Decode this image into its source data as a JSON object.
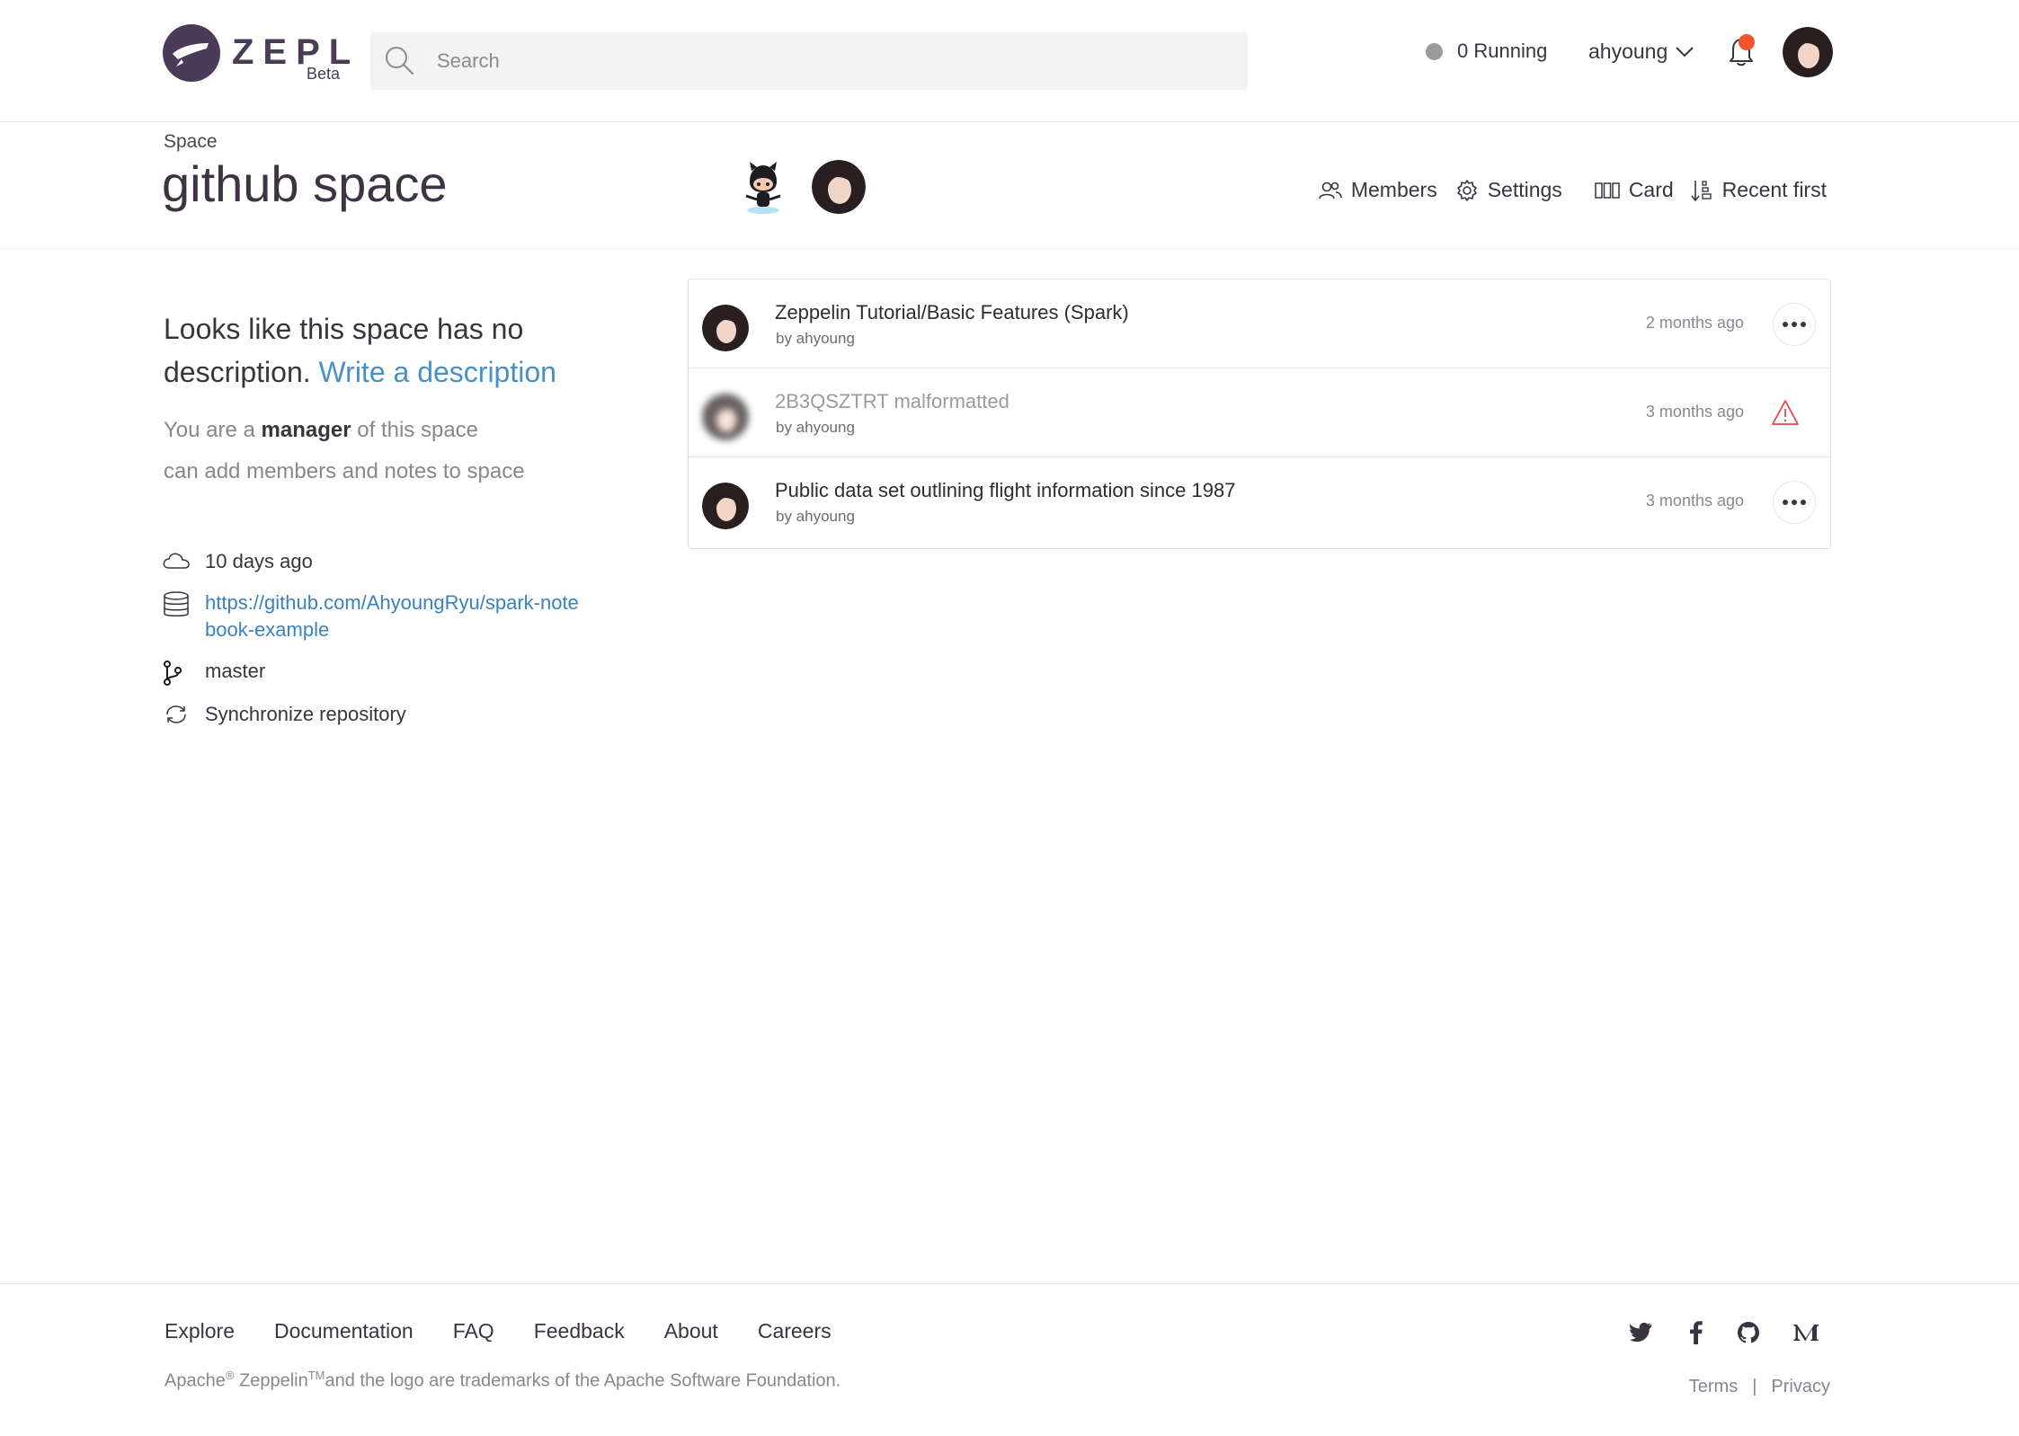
{
  "header": {
    "logo_word": "ZEPL",
    "logo_beta": "Beta",
    "search_placeholder": "Search",
    "running_label": "0 Running",
    "username": "ahyoung",
    "notification_badge_color": "#f2542d"
  },
  "space": {
    "label": "Space",
    "title": "github space"
  },
  "toolbar": {
    "members": "Members",
    "settings": "Settings",
    "card": "Card",
    "recent": "Recent first"
  },
  "description": {
    "text": "Looks like this space has no description.",
    "link": "Write a description",
    "role_prefix": "You are a",
    "role": "manager",
    "role_suffix": "of this space",
    "permissions": "can add members and notes to space"
  },
  "meta": {
    "updated": "10 days ago",
    "repo_url": "https://github.com/AhyoungRyu/spark-notebook-example",
    "branch": "master",
    "sync": "Synchronize repository"
  },
  "notes": [
    {
      "title": "Zeppelin Tutorial/Basic Features (Spark)",
      "author": "by ahyoung",
      "time": "2 months ago",
      "status": "ok"
    },
    {
      "title": "2B3QSZTRT malformatted",
      "author": "by ahyoung",
      "time": "3 months ago",
      "status": "warning"
    },
    {
      "title": "Public data set outlining flight information since 1987",
      "author": "by ahyoung",
      "time": "3 months ago",
      "status": "ok"
    }
  ],
  "footer": {
    "links": [
      "Explore",
      "Documentation",
      "FAQ",
      "Feedback",
      "About",
      "Careers"
    ],
    "trademark_apache": "Apache",
    "trademark_reg": "®",
    "trademark_zeppelin": "Zeppelin",
    "trademark_tm": "TM",
    "trademark_rest": "and the logo are trademarks of the Apache Software Foundation.",
    "terms": "Terms",
    "separator": "|",
    "privacy": "Privacy"
  },
  "colors": {
    "brand": "#4b3a58",
    "link": "#4a90c8",
    "warning": "#e5484d"
  }
}
